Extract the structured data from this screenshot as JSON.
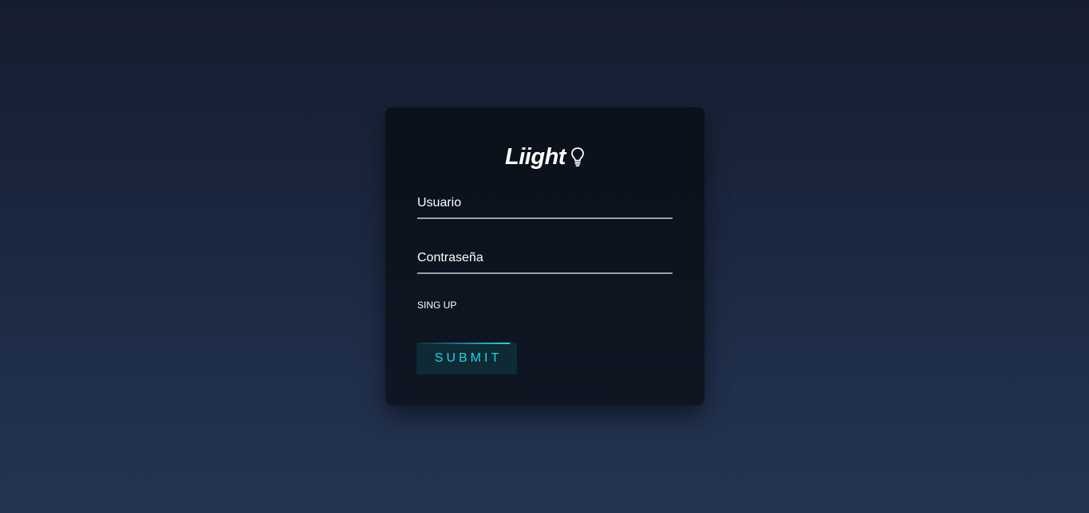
{
  "brand": {
    "name": "Liight",
    "icon": "lightbulb-icon"
  },
  "form": {
    "username": {
      "label": "Usuario",
      "value": ""
    },
    "password": {
      "label": "Contraseña",
      "value": ""
    },
    "signup_label": "SING UP",
    "submit_label": "SUBMIT"
  },
  "colors": {
    "accent": "#21d4e6",
    "card_background": "#0d131d",
    "page_background_top": "#151d2e",
    "page_background_bottom": "#233553",
    "underline": "#9aa1ab"
  }
}
